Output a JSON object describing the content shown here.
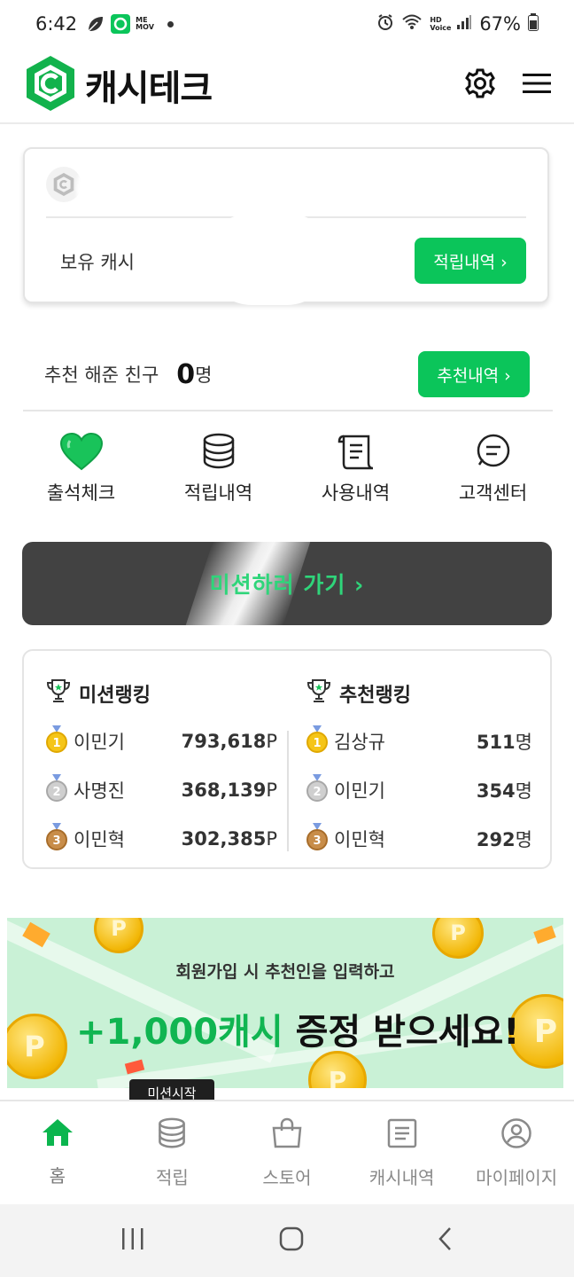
{
  "status_bar": {
    "time": "6:42",
    "battery": "67%",
    "memo_icon_text": "ME MOV",
    "hd_label": "HD Voice"
  },
  "header": {
    "app_name": "캐시테크"
  },
  "cash_card": {
    "label": "보유 캐시",
    "history_button": "적립내역 ›"
  },
  "referral": {
    "label": "추천 해준 친구",
    "count": "0",
    "unit": "명",
    "button": "추천내역 ›"
  },
  "quick_menu": [
    {
      "label": "출석체크",
      "icon": "heart-icon"
    },
    {
      "label": "적립내역",
      "icon": "coins-icon"
    },
    {
      "label": "사용내역",
      "icon": "receipt-icon"
    },
    {
      "label": "고객센터",
      "icon": "chat-icon"
    }
  ],
  "mission_banner": {
    "text": "미션하러 가기  ›"
  },
  "ranking": {
    "mission": {
      "title": "미션랭킹",
      "rows": [
        {
          "rank": "1",
          "name": "이민기",
          "score": "793,618",
          "unit": "P"
        },
        {
          "rank": "2",
          "name": "사명진",
          "score": "368,139",
          "unit": "P"
        },
        {
          "rank": "3",
          "name": "이민혁",
          "score": "302,385",
          "unit": "P"
        }
      ]
    },
    "referral": {
      "title": "추천랭킹",
      "rows": [
        {
          "rank": "1",
          "name": "김상규",
          "score": "511",
          "unit": "명"
        },
        {
          "rank": "2",
          "name": "이민기",
          "score": "354",
          "unit": "명"
        },
        {
          "rank": "3",
          "name": "이민혁",
          "score": "292",
          "unit": "명"
        }
      ]
    }
  },
  "promo": {
    "subtitle": "회원가입 시 추천인을 입력하고",
    "highlight": "+1,000캐시",
    "rest": " 증정 받으세요!",
    "coin_letter": "P"
  },
  "tooltip": {
    "text": "미션시작"
  },
  "bottom_nav": [
    {
      "label": "홈",
      "icon": "home-icon"
    },
    {
      "label": "적립",
      "icon": "coins-icon"
    },
    {
      "label": "스토어",
      "icon": "bag-icon"
    },
    {
      "label": "캐시내역",
      "icon": "list-icon"
    },
    {
      "label": "마이페이지",
      "icon": "user-icon"
    }
  ],
  "colors": {
    "accent": "#0bc55a",
    "dark_button": "#424242",
    "promo_bg": "#c9f1d6"
  }
}
